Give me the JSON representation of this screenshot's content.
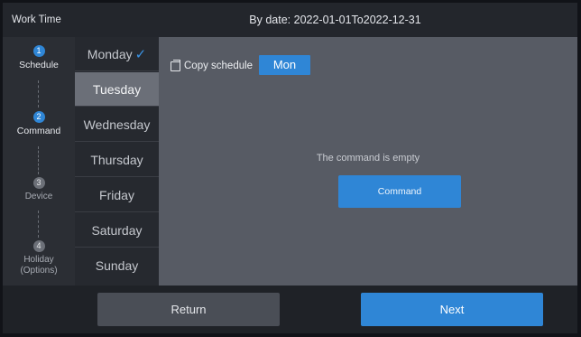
{
  "header": {
    "title": "Work Time",
    "date_range": "By date:  2022-01-01To2022-12-31"
  },
  "steps": [
    {
      "num": "1",
      "label": "Schedule",
      "state": "active"
    },
    {
      "num": "2",
      "label": "Command",
      "state": "active"
    },
    {
      "num": "3",
      "label": "Device",
      "state": "inactive"
    },
    {
      "num": "4",
      "label_line1": "Holiday",
      "label_line2": "(Options)",
      "state": "inactive"
    }
  ],
  "days": {
    "items": [
      "Monday",
      "Tuesday",
      "Wednesday",
      "Thursday",
      "Friday",
      "Saturday",
      "Sunday"
    ],
    "checked": "Monday",
    "selected": "Tuesday"
  },
  "content": {
    "copy_label": "Copy schedule",
    "copy_day": "Mon",
    "empty_text": "The command is empty",
    "command_button": "Command"
  },
  "footer": {
    "return_label": "Return",
    "next_label": "Next"
  },
  "colors": {
    "accent": "#2f86d6",
    "selected_day": "#6b6f78",
    "content_bg": "#575b64"
  }
}
